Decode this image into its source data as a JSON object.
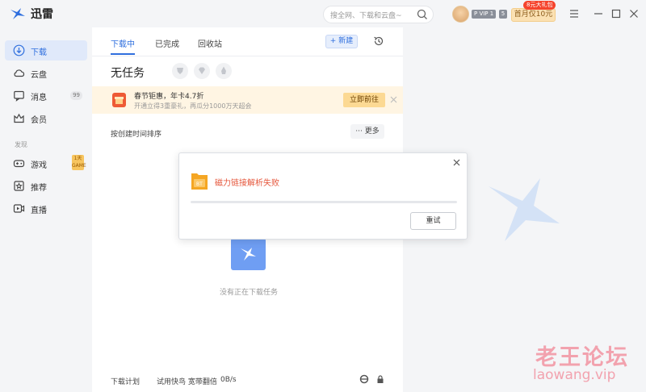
{
  "app": {
    "name": "迅雷"
  },
  "search": {
    "placeholder": "搜全网、下载和云盘~"
  },
  "account": {
    "vip_label": "P VIP 1",
    "vip_level": "5",
    "promo_button": "首月仅10元",
    "promo_tag": "8元大礼包"
  },
  "sidebar": {
    "items": [
      {
        "label": "下载",
        "icon": "download-icon",
        "active": true
      },
      {
        "label": "云盘",
        "icon": "cloud-icon"
      },
      {
        "label": "消息",
        "icon": "message-icon",
        "badge": "99"
      },
      {
        "label": "会员",
        "icon": "crown-icon"
      }
    ],
    "section_title": "发现",
    "discover_items": [
      {
        "label": "游戏",
        "icon": "gamepad-icon",
        "badge": "1天 GAME"
      },
      {
        "label": "推荐",
        "icon": "star-icon"
      },
      {
        "label": "直播",
        "icon": "live-icon"
      }
    ]
  },
  "tabs": [
    {
      "label": "下载中",
      "active": true
    },
    {
      "label": "已完成"
    },
    {
      "label": "回收站"
    }
  ],
  "toolbar": {
    "new_button": "+ 新建"
  },
  "main": {
    "title": "无任务",
    "sort_label": "按创建时间排序",
    "more_button": "··· 更多",
    "empty_text": "没有正在下载任务"
  },
  "banner": {
    "title": "春节钜惠，年卡4.7折",
    "subtitle": "开通立得3重豪礼，再瓜分1000万天超会",
    "button": "立即前往"
  },
  "modal": {
    "message": "磁力链接解析失败",
    "retry_button": "重试",
    "progress": 0,
    "file_badge": "BT"
  },
  "footer": {
    "plan": "下载计划",
    "speedup": "试用快鸟 宽带翻倍",
    "speed": "0B/s"
  },
  "watermark": {
    "cn": "老王论坛",
    "en": "laowang.vip"
  },
  "colors": {
    "accent": "#2f6fde",
    "error": "#e5563b",
    "banner_bg": "#fff5e3"
  }
}
